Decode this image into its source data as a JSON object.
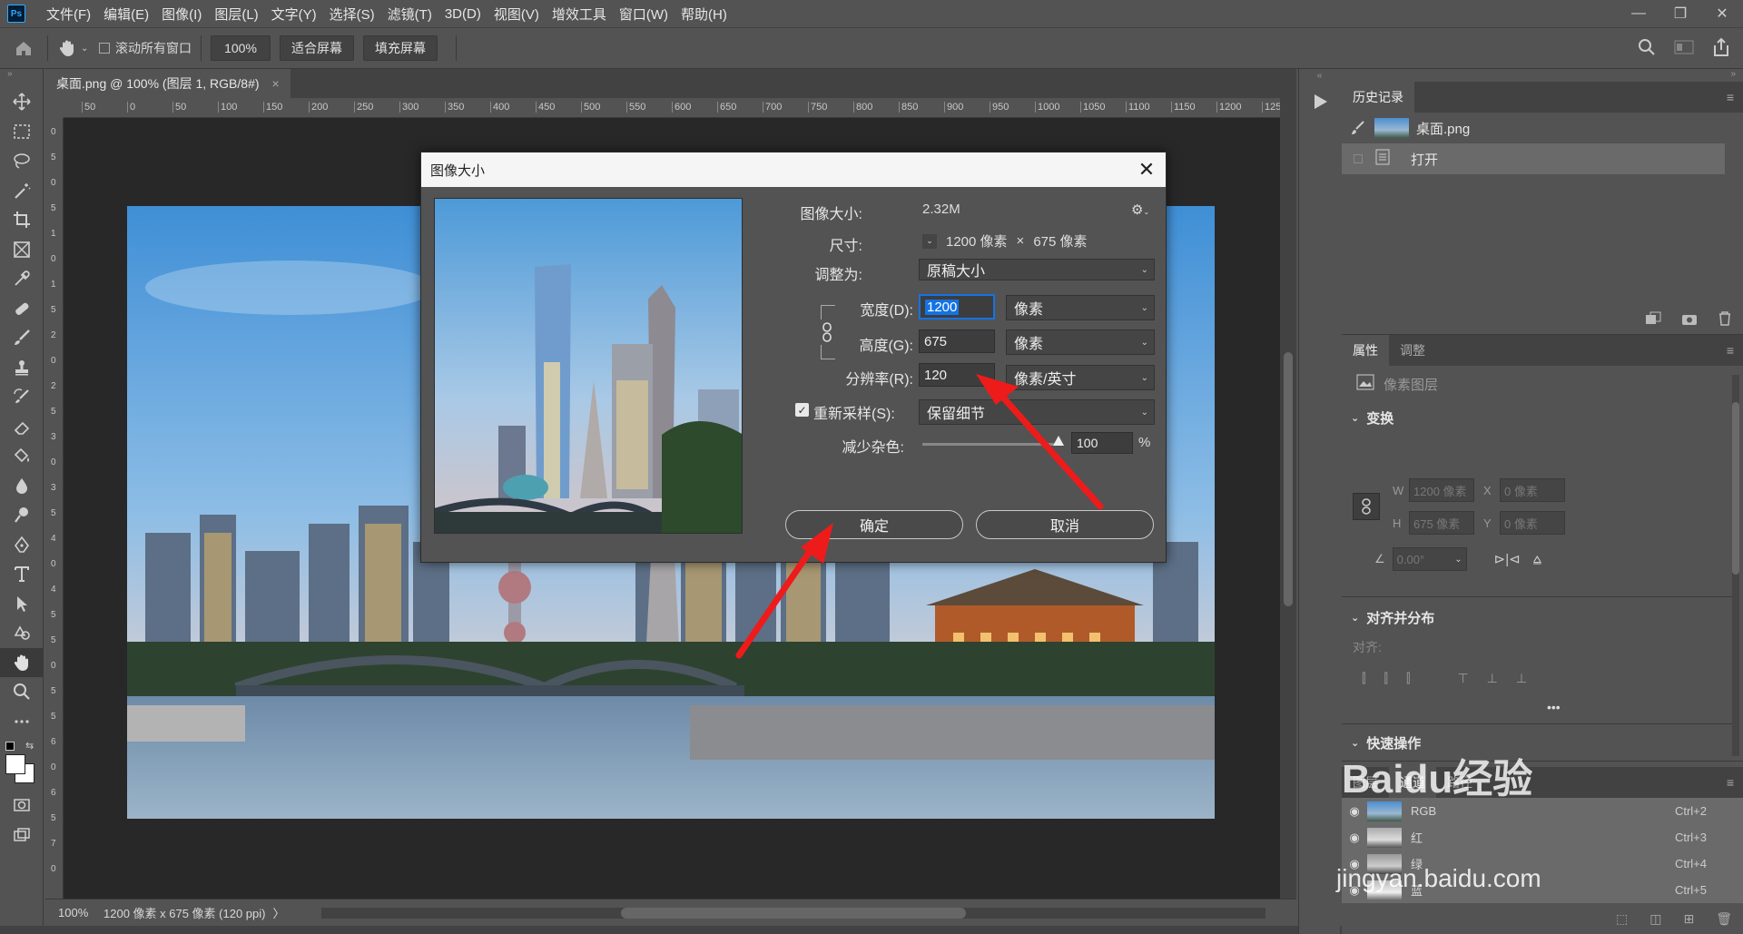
{
  "menubar": {
    "logo": "Ps",
    "items": [
      "文件(F)",
      "编辑(E)",
      "图像(I)",
      "图层(L)",
      "文字(Y)",
      "选择(S)",
      "滤镜(T)",
      "3D(D)",
      "视图(V)",
      "增效工具",
      "窗口(W)",
      "帮助(H)"
    ],
    "min": "—",
    "restore": "❐",
    "close": "✕"
  },
  "options": {
    "scroll_all": "滚动所有窗口",
    "zoom": "100%",
    "fit_screen": "适合屏幕",
    "fill_screen": "填充屏幕"
  },
  "document": {
    "tab_title": "桌面.png @ 100% (图层 1, RGB/8#)",
    "tab_close": "×",
    "ruler_h": [
      "50",
      "0",
      "50",
      "100",
      "150",
      "200",
      "250",
      "300",
      "350",
      "400",
      "450",
      "500",
      "550",
      "600",
      "650",
      "700",
      "750",
      "800",
      "850",
      "900",
      "950",
      "1000",
      "1050",
      "1100",
      "1150",
      "1200",
      "125"
    ],
    "ruler_v": [
      "0",
      "5",
      "0",
      "5",
      "1",
      "0",
      "1",
      "5",
      "2",
      "0",
      "2",
      "5",
      "3",
      "0",
      "3",
      "5",
      "4",
      "0",
      "4",
      "5",
      "5",
      "0",
      "5",
      "5",
      "6",
      "0",
      "6",
      "5",
      "7",
      "0"
    ]
  },
  "status": {
    "zoom": "100%",
    "info": "1200 像素 x 675 像素 (120 ppi)",
    "arrow": "〉"
  },
  "dialog": {
    "title": "图像大小",
    "image_size_label": "图像大小:",
    "image_size_value": "2.32M",
    "dimensions_label": "尺寸:",
    "dim_w": "1200 像素",
    "dim_x": "×",
    "dim_h": "675 像素",
    "fit_label": "调整为:",
    "fit_value": "原稿大小",
    "width_label": "宽度(D):",
    "width_value": "1200",
    "width_unit": "像素",
    "height_label": "高度(G):",
    "height_value": "675",
    "height_unit": "像素",
    "res_label": "分辨率(R):",
    "res_value": "120",
    "res_unit": "像素/英寸",
    "resample_label": "重新采样(S):",
    "resample_value": "保留细节",
    "noise_label": "减少杂色:",
    "noise_value": "100",
    "noise_unit": "%",
    "ok": "确定",
    "cancel": "取消"
  },
  "history": {
    "tab": "历史记录",
    "snapshot": "桌面.png",
    "step": "打开"
  },
  "properties": {
    "tab1": "属性",
    "tab2": "调整",
    "layer_type": "像素图层",
    "transform": "变换",
    "w_label": "W",
    "w_value": "1200 像素",
    "x_label": "X",
    "x_value": "0 像素",
    "h_label": "H",
    "h_value": "675 像素",
    "y_label": "Y",
    "y_value": "0 像素",
    "angle": "0.00°",
    "align": "对齐并分布",
    "align_label": "对齐:",
    "more": "•••",
    "quick": "快速操作"
  },
  "channels": {
    "tabs": [
      "图层",
      "通道",
      "路径"
    ],
    "rows": [
      {
        "name": "RGB",
        "shortcut": "Ctrl+2"
      },
      {
        "name": "红",
        "shortcut": "Ctrl+3"
      },
      {
        "name": "绿",
        "shortcut": "Ctrl+4"
      },
      {
        "name": "蓝",
        "shortcut": "Ctrl+5"
      }
    ]
  },
  "watermark": {
    "brand": "Baidu经验",
    "url": "jingyan.baidu.com"
  }
}
